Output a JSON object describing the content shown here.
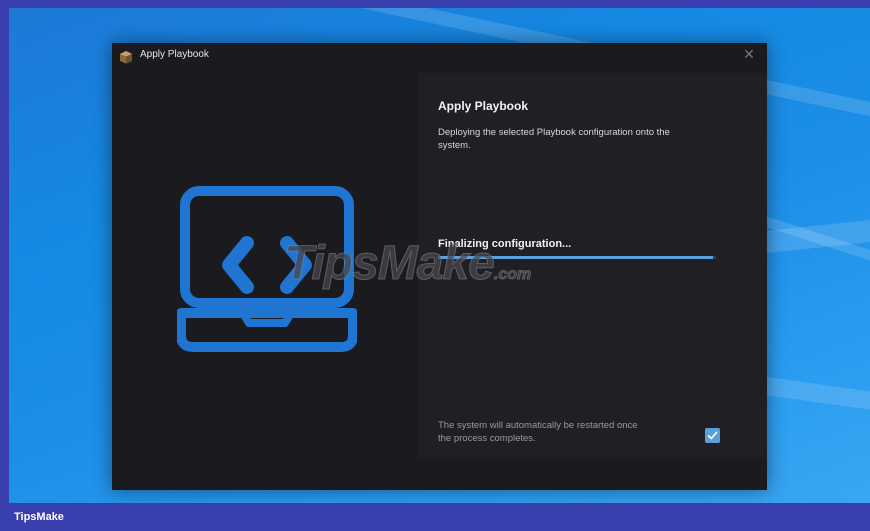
{
  "window": {
    "title": "Apply Playbook",
    "close_glyph": "✕",
    "app_icon": "package-box-icon"
  },
  "pane": {
    "title": "Apply Playbook",
    "description": "Deploying the selected Playbook configuration onto the system.",
    "status": "Finalizing configuration...",
    "progress": 0.99,
    "restart_note": "The system will automatically be restarted once the process completes.",
    "restart_checked": true
  },
  "illustration": {
    "icon": "laptop-code-icon",
    "color": "#1f75d1"
  },
  "watermark": {
    "text": "TipsMake",
    "suffix": ".com"
  },
  "footer": {
    "brand": "TipsMake"
  },
  "colors": {
    "accent": "#5aa0e0",
    "window_bg": "#1b1b1f",
    "pane_bg": "#202024",
    "footer_bg": "#3a3fb0"
  }
}
